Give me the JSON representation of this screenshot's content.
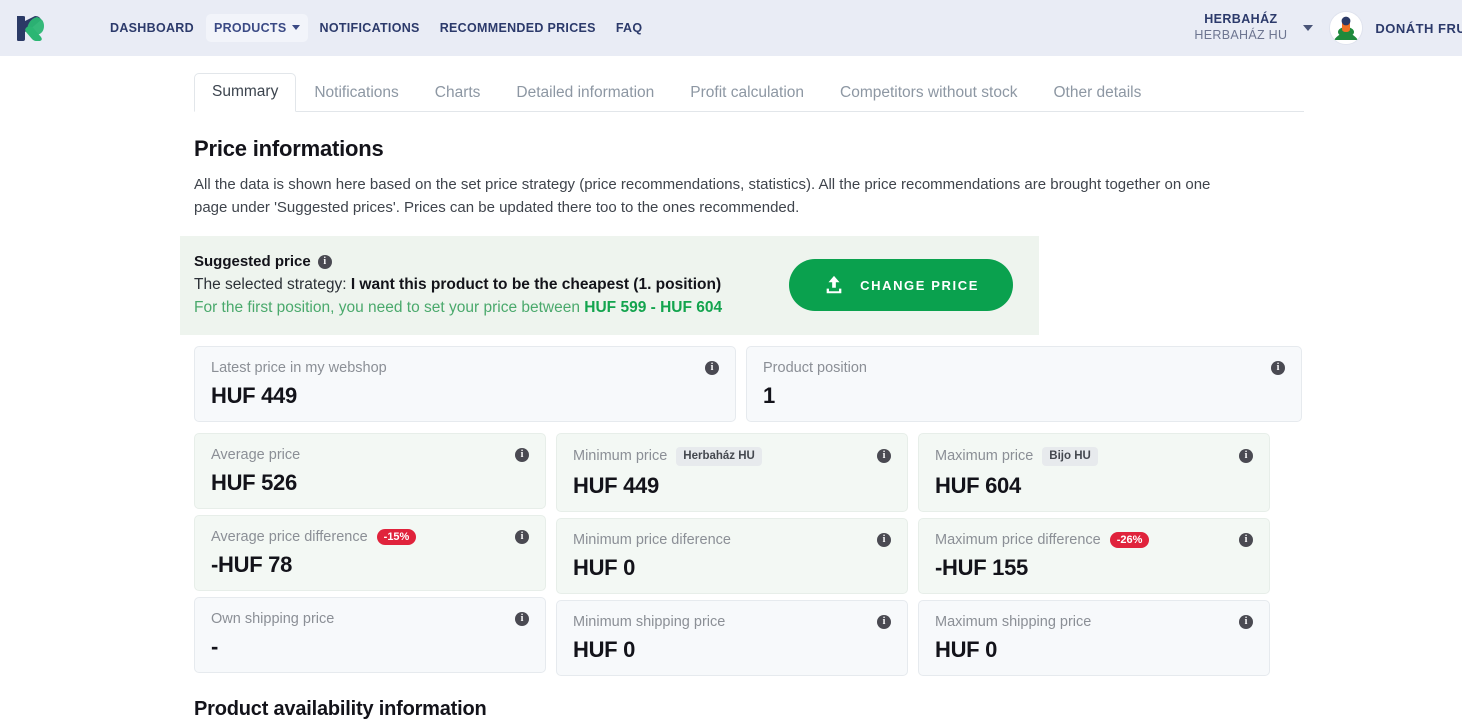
{
  "header": {
    "logo_icon": "kolibri-k-logo",
    "nav": [
      {
        "label": "DASHBOARD",
        "active": false,
        "caret": false
      },
      {
        "label": "PRODUCTS",
        "active": true,
        "caret": true
      },
      {
        "label": "NOTIFICATIONS",
        "active": false,
        "caret": false
      },
      {
        "label": "RECOMMENDED PRICES",
        "active": false,
        "caret": false
      },
      {
        "label": "FAQ",
        "active": false,
        "caret": false
      }
    ],
    "shop": {
      "name": "HERBAHÁZ",
      "sub": "HERBAHÁZ HU"
    },
    "user": {
      "name": "DONÁTH FRUZSI",
      "avatar_icon": "user-avatar-icon"
    }
  },
  "tabs": [
    {
      "label": "Summary",
      "active": true
    },
    {
      "label": "Notifications",
      "active": false
    },
    {
      "label": "Charts",
      "active": false
    },
    {
      "label": "Detailed information",
      "active": false
    },
    {
      "label": "Profit calculation",
      "active": false
    },
    {
      "label": "Competitors without stock",
      "active": false
    },
    {
      "label": "Other details",
      "active": false
    }
  ],
  "main": {
    "title": "Price informations",
    "description": "All the data is shown here based on the set price strategy (price recommendations, statistics). All the price recommendations are brought together on one page under 'Suggested prices'. Prices can be updated there too to the ones recommended.",
    "suggested": {
      "heading": "Suggested price",
      "info_icon": "info-icon",
      "strategy_prefix": "The selected strategy: ",
      "strategy_value": "I want this product to be the cheapest (1. position)",
      "range_prefix": "For the first position, you need to set your price between ",
      "range_value": "HUF 599 - HUF 604",
      "button_label": "CHANGE PRICE",
      "button_icon": "upload-icon",
      "accent_color": "#0aa14e",
      "panel_bg": "#eef4ee"
    },
    "cards": {
      "latest_price": {
        "label": "Latest price in my webshop",
        "value": "HUF 449"
      },
      "product_position": {
        "label": "Product position",
        "value": "1"
      },
      "average_price": {
        "label": "Average price",
        "value": "HUF 526"
      },
      "average_price_difference": {
        "label": "Average price difference",
        "badge": "-15%",
        "value": "-HUF 78",
        "badge_color": "#e0233c"
      },
      "own_shipping_price": {
        "label": "Own shipping price",
        "value": "-"
      },
      "minimum_price": {
        "label": "Minimum price",
        "chip": "Herbaház HU",
        "value": "HUF 449"
      },
      "minimum_price_difference": {
        "label": "Minimum price diference",
        "value": "HUF 0"
      },
      "minimum_shipping_price": {
        "label": "Minimum shipping price",
        "value": "HUF 0"
      },
      "maximum_price": {
        "label": "Maximum price",
        "chip": "Bijo HU",
        "value": "HUF 604"
      },
      "maximum_price_difference": {
        "label": "Maximum price difference",
        "badge": "-26%",
        "value": "-HUF 155",
        "badge_color": "#e0233c"
      },
      "maximum_shipping_price": {
        "label": "Maximum shipping price",
        "value": "HUF 0"
      }
    },
    "availability_title": "Product availability information"
  }
}
